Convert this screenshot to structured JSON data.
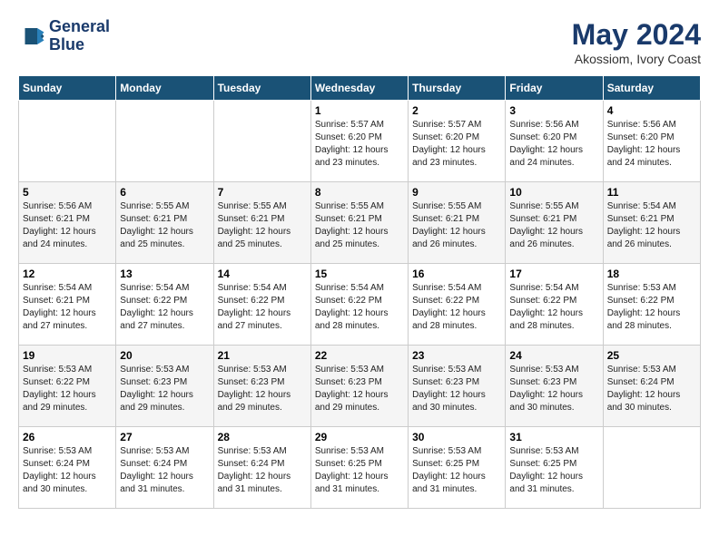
{
  "header": {
    "logo_line1": "General",
    "logo_line2": "Blue",
    "month_year": "May 2024",
    "location": "Akossiom, Ivory Coast"
  },
  "weekdays": [
    "Sunday",
    "Monday",
    "Tuesday",
    "Wednesday",
    "Thursday",
    "Friday",
    "Saturday"
  ],
  "weeks": [
    [
      {
        "day": "",
        "sunrise": "",
        "sunset": "",
        "daylight": ""
      },
      {
        "day": "",
        "sunrise": "",
        "sunset": "",
        "daylight": ""
      },
      {
        "day": "",
        "sunrise": "",
        "sunset": "",
        "daylight": ""
      },
      {
        "day": "1",
        "sunrise": "Sunrise: 5:57 AM",
        "sunset": "Sunset: 6:20 PM",
        "daylight": "Daylight: 12 hours and 23 minutes."
      },
      {
        "day": "2",
        "sunrise": "Sunrise: 5:57 AM",
        "sunset": "Sunset: 6:20 PM",
        "daylight": "Daylight: 12 hours and 23 minutes."
      },
      {
        "day": "3",
        "sunrise": "Sunrise: 5:56 AM",
        "sunset": "Sunset: 6:20 PM",
        "daylight": "Daylight: 12 hours and 24 minutes."
      },
      {
        "day": "4",
        "sunrise": "Sunrise: 5:56 AM",
        "sunset": "Sunset: 6:20 PM",
        "daylight": "Daylight: 12 hours and 24 minutes."
      }
    ],
    [
      {
        "day": "5",
        "sunrise": "Sunrise: 5:56 AM",
        "sunset": "Sunset: 6:21 PM",
        "daylight": "Daylight: 12 hours and 24 minutes."
      },
      {
        "day": "6",
        "sunrise": "Sunrise: 5:55 AM",
        "sunset": "Sunset: 6:21 PM",
        "daylight": "Daylight: 12 hours and 25 minutes."
      },
      {
        "day": "7",
        "sunrise": "Sunrise: 5:55 AM",
        "sunset": "Sunset: 6:21 PM",
        "daylight": "Daylight: 12 hours and 25 minutes."
      },
      {
        "day": "8",
        "sunrise": "Sunrise: 5:55 AM",
        "sunset": "Sunset: 6:21 PM",
        "daylight": "Daylight: 12 hours and 25 minutes."
      },
      {
        "day": "9",
        "sunrise": "Sunrise: 5:55 AM",
        "sunset": "Sunset: 6:21 PM",
        "daylight": "Daylight: 12 hours and 26 minutes."
      },
      {
        "day": "10",
        "sunrise": "Sunrise: 5:55 AM",
        "sunset": "Sunset: 6:21 PM",
        "daylight": "Daylight: 12 hours and 26 minutes."
      },
      {
        "day": "11",
        "sunrise": "Sunrise: 5:54 AM",
        "sunset": "Sunset: 6:21 PM",
        "daylight": "Daylight: 12 hours and 26 minutes."
      }
    ],
    [
      {
        "day": "12",
        "sunrise": "Sunrise: 5:54 AM",
        "sunset": "Sunset: 6:21 PM",
        "daylight": "Daylight: 12 hours and 27 minutes."
      },
      {
        "day": "13",
        "sunrise": "Sunrise: 5:54 AM",
        "sunset": "Sunset: 6:22 PM",
        "daylight": "Daylight: 12 hours and 27 minutes."
      },
      {
        "day": "14",
        "sunrise": "Sunrise: 5:54 AM",
        "sunset": "Sunset: 6:22 PM",
        "daylight": "Daylight: 12 hours and 27 minutes."
      },
      {
        "day": "15",
        "sunrise": "Sunrise: 5:54 AM",
        "sunset": "Sunset: 6:22 PM",
        "daylight": "Daylight: 12 hours and 28 minutes."
      },
      {
        "day": "16",
        "sunrise": "Sunrise: 5:54 AM",
        "sunset": "Sunset: 6:22 PM",
        "daylight": "Daylight: 12 hours and 28 minutes."
      },
      {
        "day": "17",
        "sunrise": "Sunrise: 5:54 AM",
        "sunset": "Sunset: 6:22 PM",
        "daylight": "Daylight: 12 hours and 28 minutes."
      },
      {
        "day": "18",
        "sunrise": "Sunrise: 5:53 AM",
        "sunset": "Sunset: 6:22 PM",
        "daylight": "Daylight: 12 hours and 28 minutes."
      }
    ],
    [
      {
        "day": "19",
        "sunrise": "Sunrise: 5:53 AM",
        "sunset": "Sunset: 6:22 PM",
        "daylight": "Daylight: 12 hours and 29 minutes."
      },
      {
        "day": "20",
        "sunrise": "Sunrise: 5:53 AM",
        "sunset": "Sunset: 6:23 PM",
        "daylight": "Daylight: 12 hours and 29 minutes."
      },
      {
        "day": "21",
        "sunrise": "Sunrise: 5:53 AM",
        "sunset": "Sunset: 6:23 PM",
        "daylight": "Daylight: 12 hours and 29 minutes."
      },
      {
        "day": "22",
        "sunrise": "Sunrise: 5:53 AM",
        "sunset": "Sunset: 6:23 PM",
        "daylight": "Daylight: 12 hours and 29 minutes."
      },
      {
        "day": "23",
        "sunrise": "Sunrise: 5:53 AM",
        "sunset": "Sunset: 6:23 PM",
        "daylight": "Daylight: 12 hours and 30 minutes."
      },
      {
        "day": "24",
        "sunrise": "Sunrise: 5:53 AM",
        "sunset": "Sunset: 6:23 PM",
        "daylight": "Daylight: 12 hours and 30 minutes."
      },
      {
        "day": "25",
        "sunrise": "Sunrise: 5:53 AM",
        "sunset": "Sunset: 6:24 PM",
        "daylight": "Daylight: 12 hours and 30 minutes."
      }
    ],
    [
      {
        "day": "26",
        "sunrise": "Sunrise: 5:53 AM",
        "sunset": "Sunset: 6:24 PM",
        "daylight": "Daylight: 12 hours and 30 minutes."
      },
      {
        "day": "27",
        "sunrise": "Sunrise: 5:53 AM",
        "sunset": "Sunset: 6:24 PM",
        "daylight": "Daylight: 12 hours and 31 minutes."
      },
      {
        "day": "28",
        "sunrise": "Sunrise: 5:53 AM",
        "sunset": "Sunset: 6:24 PM",
        "daylight": "Daylight: 12 hours and 31 minutes."
      },
      {
        "day": "29",
        "sunrise": "Sunrise: 5:53 AM",
        "sunset": "Sunset: 6:25 PM",
        "daylight": "Daylight: 12 hours and 31 minutes."
      },
      {
        "day": "30",
        "sunrise": "Sunrise: 5:53 AM",
        "sunset": "Sunset: 6:25 PM",
        "daylight": "Daylight: 12 hours and 31 minutes."
      },
      {
        "day": "31",
        "sunrise": "Sunrise: 5:53 AM",
        "sunset": "Sunset: 6:25 PM",
        "daylight": "Daylight: 12 hours and 31 minutes."
      },
      {
        "day": "",
        "sunrise": "",
        "sunset": "",
        "daylight": ""
      }
    ]
  ]
}
